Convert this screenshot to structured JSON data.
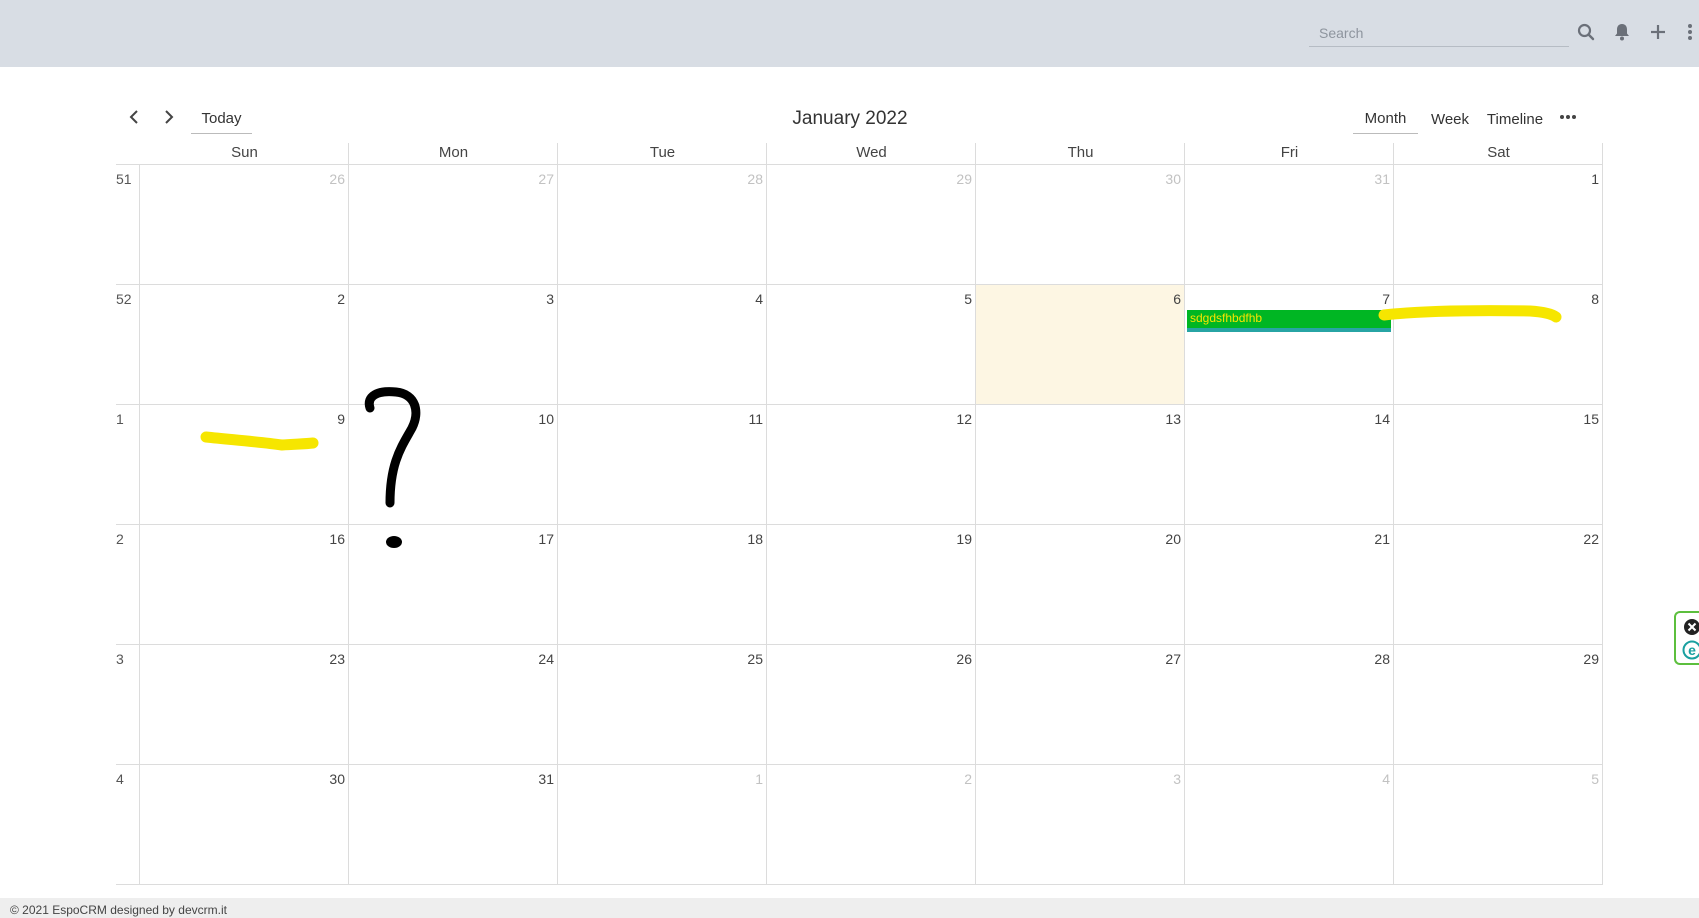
{
  "search": {
    "placeholder": "Search"
  },
  "calendar": {
    "title": "January 2022",
    "today_label": "Today",
    "views": [
      "Month",
      "Week",
      "Timeline"
    ],
    "active_view": "Month",
    "weekdays": [
      "Sun",
      "Mon",
      "Tue",
      "Wed",
      "Thu",
      "Fri",
      "Sat"
    ],
    "weeks": [
      {
        "number": "51",
        "days": [
          "26",
          "27",
          "28",
          "29",
          "30",
          "31",
          "1"
        ]
      },
      {
        "number": "52",
        "days": [
          "2",
          "3",
          "4",
          "5",
          "6",
          "7",
          "8"
        ]
      },
      {
        "number": "1",
        "days": [
          "9",
          "10",
          "11",
          "12",
          "13",
          "14",
          "15"
        ]
      },
      {
        "number": "2",
        "days": [
          "16",
          "17",
          "18",
          "19",
          "20",
          "21",
          "22"
        ]
      },
      {
        "number": "3",
        "days": [
          "23",
          "24",
          "25",
          "26",
          "27",
          "28",
          "29"
        ]
      },
      {
        "number": "4",
        "days": [
          "30",
          "31",
          "1",
          "2",
          "3",
          "4",
          "5"
        ]
      }
    ],
    "event": {
      "title": "sdgdsfhbdfhb",
      "day": "7"
    },
    "today_day": "6"
  },
  "footer": {
    "text": "© 2021 EspoCRM designed by devcrm.it"
  },
  "colors": {
    "navbar": "#d8dde4",
    "event_bg": "#00b623",
    "event_text": "#f7e400",
    "today_bg": "#fdf6e3",
    "highlight_marker": "#f6e600"
  }
}
